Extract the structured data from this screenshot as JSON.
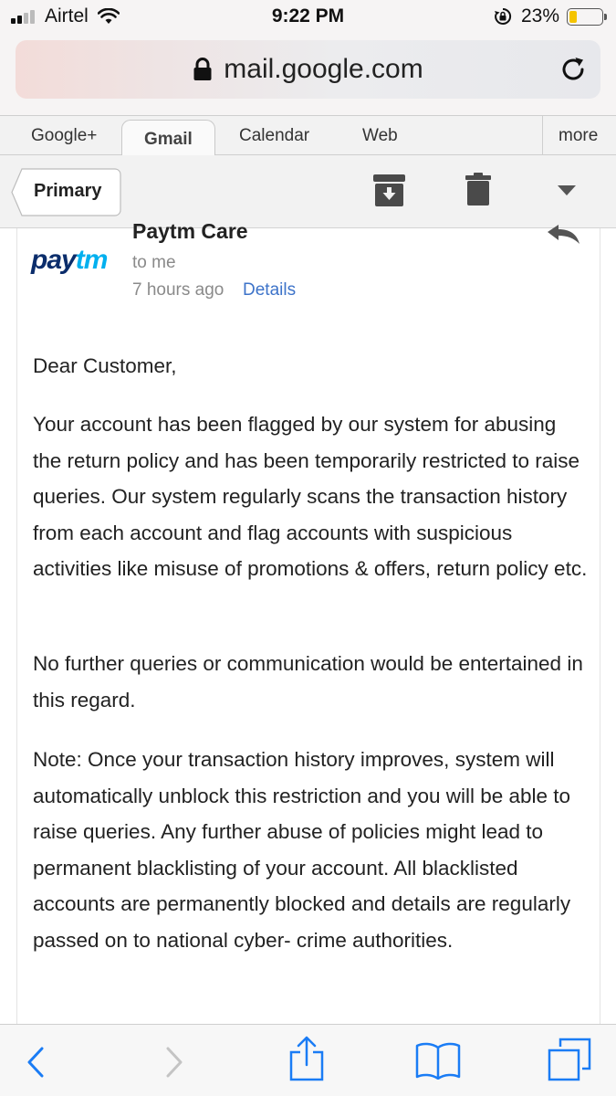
{
  "status_bar": {
    "carrier": "Airtel",
    "time": "9:22 PM",
    "battery_percent": "23%",
    "battery_level": 0.23
  },
  "browser": {
    "url": "mail.google.com"
  },
  "google_tabs": [
    {
      "label": "Google+"
    },
    {
      "label": "Gmail"
    },
    {
      "label": "Calendar"
    },
    {
      "label": "Web"
    },
    {
      "label": "more"
    }
  ],
  "toolbar": {
    "back_label": "Primary"
  },
  "email": {
    "sender": "Paytm Care",
    "logo_text_a": "pay",
    "logo_text_b": "tm",
    "recipient": "to me",
    "time_ago": "7 hours ago",
    "details_label": "Details",
    "paragraphs": [
      "Dear Customer,",
      "Your account has been flagged by our system for abusing the return policy and has been temporarily restricted to raise queries. Our system regularly scans the transaction history from each account and flag accounts with suspicious activities like misuse of promotions & offers, return policy etc.",
      "No further queries or communication would be entertained in this regard.",
      "Note: Once your transaction history improves, system will automatically unblock this restriction and you will be able to raise queries. Any further abuse of policies might lead to permanent blacklisting of your account. All blacklisted accounts are permanently blocked and details are regularly passed on to national cyber- crime authorities."
    ]
  },
  "colors": {
    "link": "#3d73c9",
    "paytm_dark": "#0b2d6b",
    "paytm_light": "#00b0ef",
    "ios_blue": "#1a7cf5",
    "battery": "#f5c400"
  }
}
